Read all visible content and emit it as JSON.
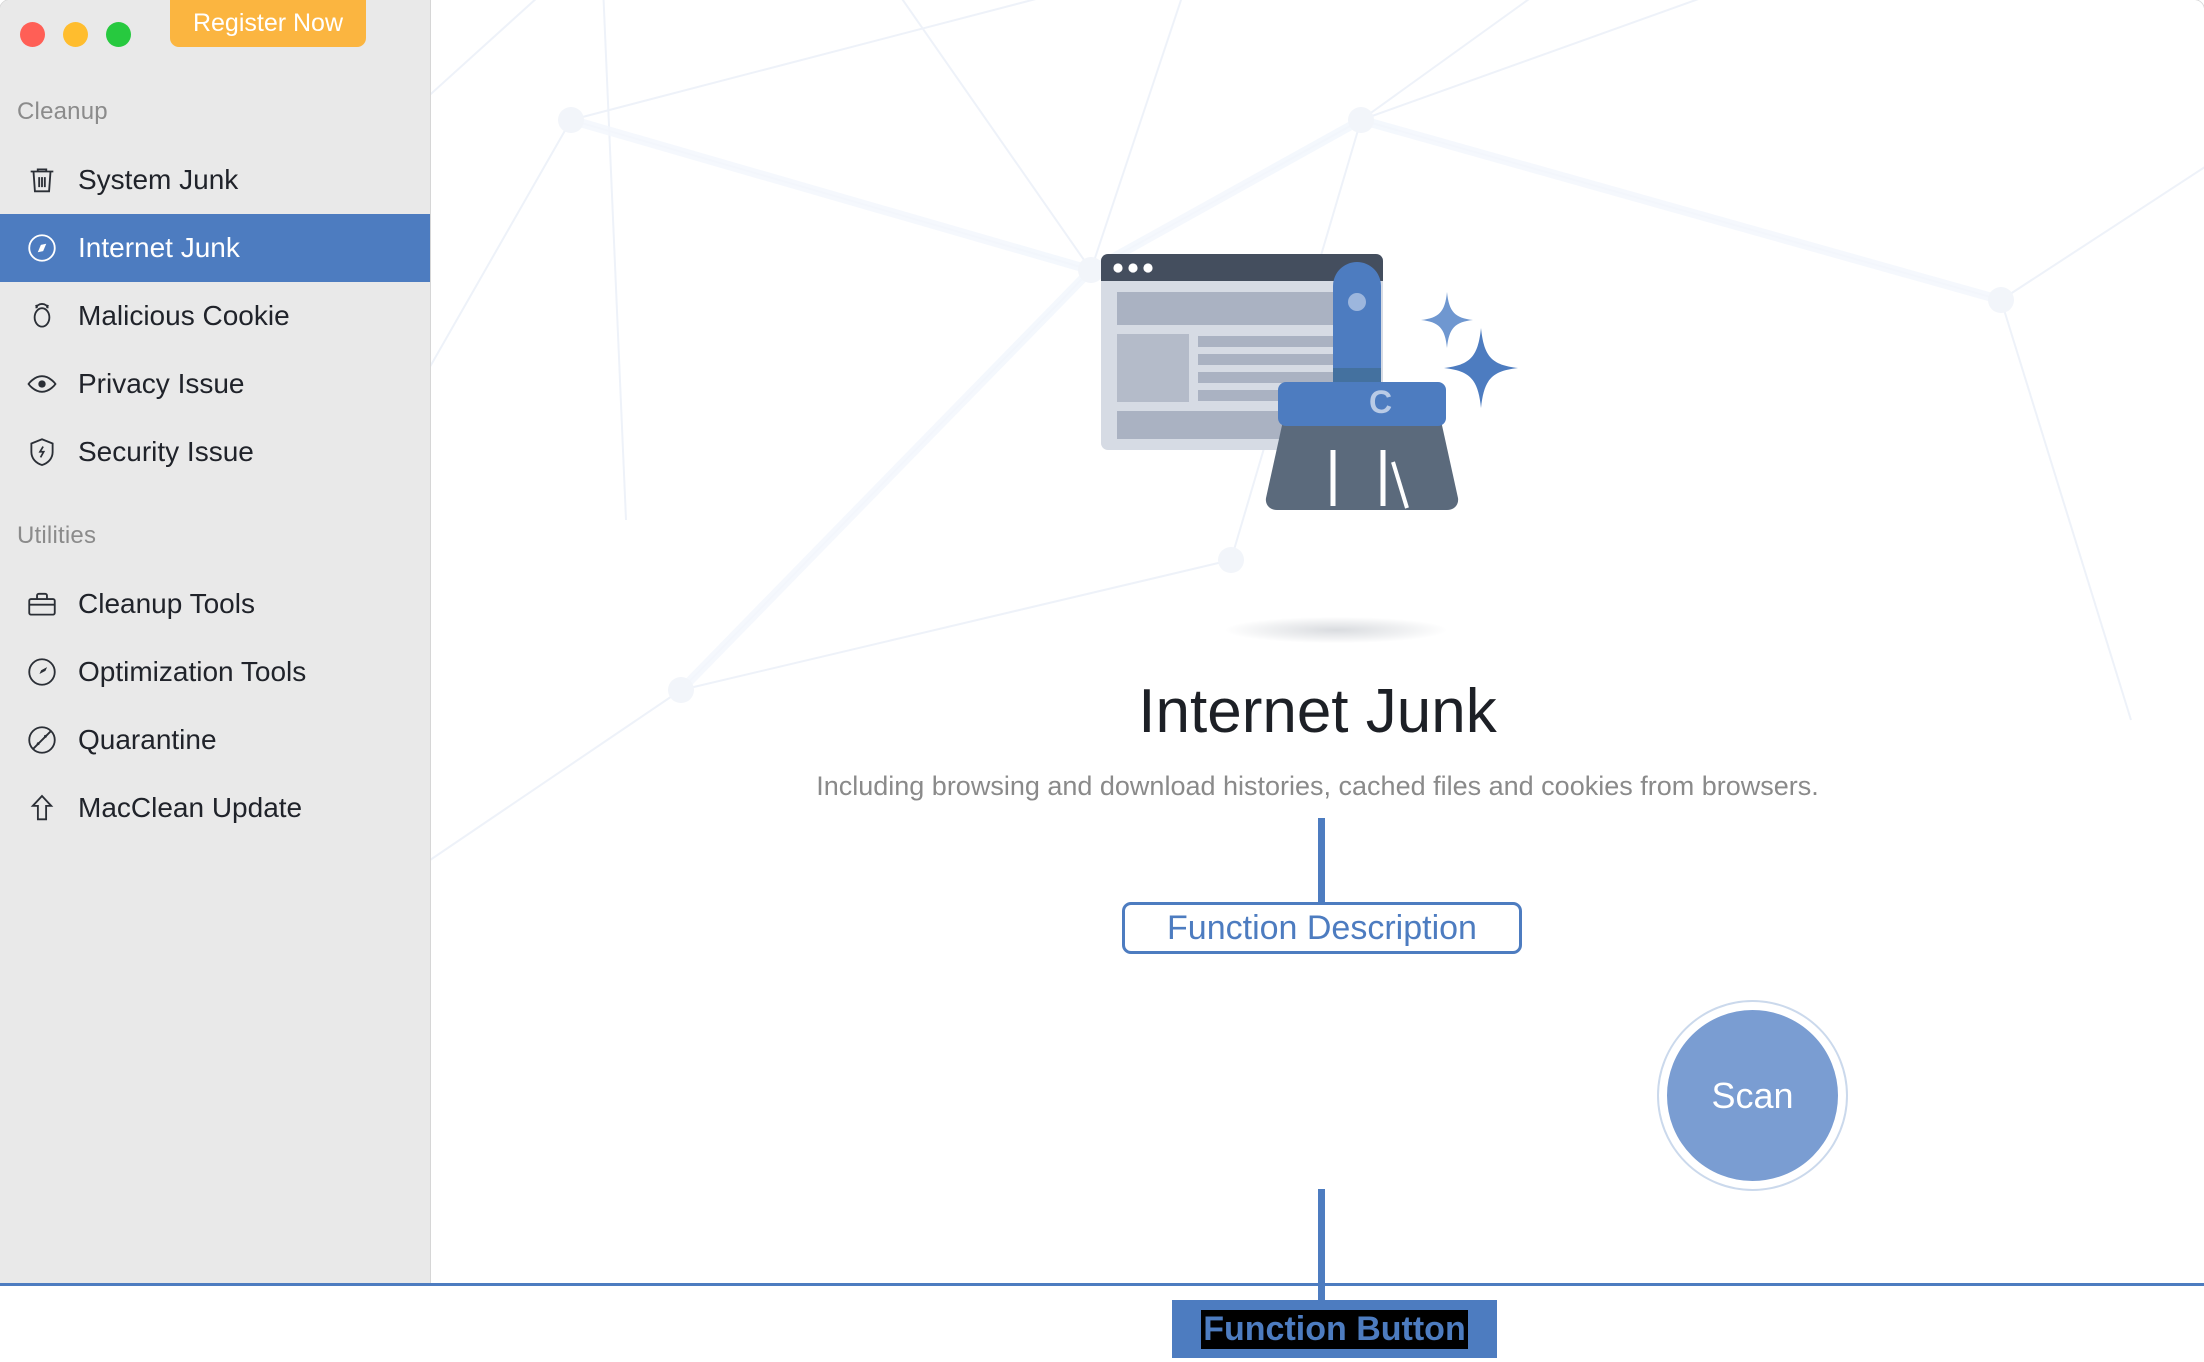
{
  "window": {
    "traffic_lights": [
      {
        "name": "close",
        "color": "#ff5f56"
      },
      {
        "name": "minimize",
        "color": "#ffbd2e"
      },
      {
        "name": "maximize",
        "color": "#27c93f"
      }
    ],
    "register_button": "Register Now"
  },
  "sidebar": {
    "sections": [
      {
        "title": "Cleanup",
        "items": [
          {
            "label": "System Junk",
            "icon": "trash-icon",
            "selected": false
          },
          {
            "label": "Internet Junk",
            "icon": "compass-icon",
            "selected": true
          },
          {
            "label": "Malicious Cookie",
            "icon": "bug-icon",
            "selected": false
          },
          {
            "label": "Privacy Issue",
            "icon": "eye-icon",
            "selected": false
          },
          {
            "label": "Security Issue",
            "icon": "shield-icon",
            "selected": false
          }
        ]
      },
      {
        "title": "Utilities",
        "items": [
          {
            "label": "Cleanup Tools",
            "icon": "toolbox-icon",
            "selected": false
          },
          {
            "label": "Optimization Tools",
            "icon": "speedometer-icon",
            "selected": false
          },
          {
            "label": "Quarantine",
            "icon": "no-entry-icon",
            "selected": false
          },
          {
            "label": "MacClean Update",
            "icon": "arrow-up-icon",
            "selected": false
          }
        ]
      }
    ]
  },
  "main": {
    "title": "Internet Junk",
    "subtitle": "Including browsing and download histories, cached files and cookies from browsers.",
    "scan_button": "Scan",
    "illustration": {
      "name": "browser-cleanup-illustration",
      "brush_letter": "C"
    }
  },
  "annotations": {
    "description_label": "Function Description",
    "button_label": "Function Button",
    "accent_color": "#4d7cc0"
  },
  "colors": {
    "sidebar_bg": "#e9e9e9",
    "selected_nav": "#4d7cc0",
    "register_orange": "#fbb540",
    "scan_blue": "#7a9dd2",
    "title_text": "#1d2026",
    "subtitle_text": "#8a8a8a",
    "section_text": "#8b8b8b"
  }
}
